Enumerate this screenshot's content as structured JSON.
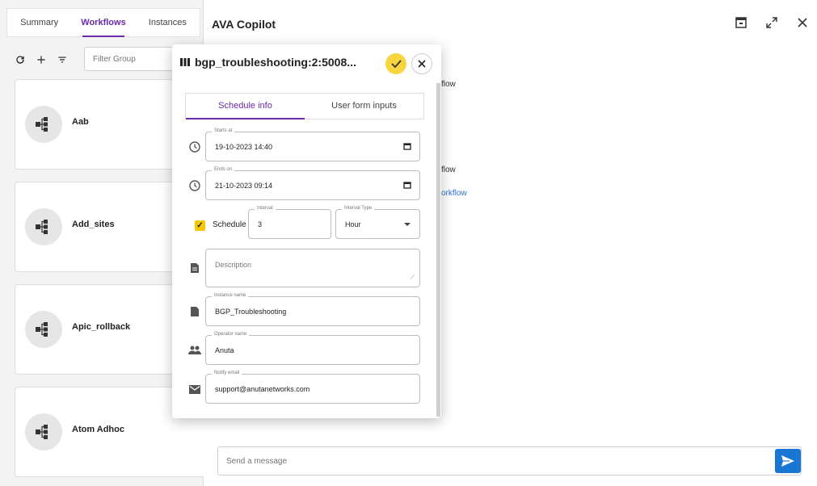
{
  "left_panel": {
    "tabs": [
      "Summary",
      "Workflows",
      "Instances"
    ],
    "active_tab": "Workflows",
    "toolbar": {
      "refresh_icon": "refresh-icon",
      "add_icon": "plus-icon",
      "filter_icon": "filter-icon",
      "filter_placeholder": "Filter Group"
    },
    "workflows": [
      {
        "name": "Aab"
      },
      {
        "name": "Add_sites"
      },
      {
        "name": "Apic_rollback"
      },
      {
        "name": "Atom Adhoc"
      }
    ]
  },
  "right_panel": {
    "title": "AVA Copilot",
    "header_icons": [
      "open-in-panel-icon",
      "expand-icon",
      "close-icon"
    ],
    "chat_fragments": {
      "line1": "flow",
      "line2": "flow",
      "line3": "orkflow"
    },
    "message_placeholder": "Send a message",
    "send_icon": "send-icon"
  },
  "modal": {
    "title": "bgp_troubleshooting:2:5008...",
    "confirm_icon": "check-icon",
    "close_icon": "close-icon",
    "tabs": [
      "Schedule info",
      "User form inputs"
    ],
    "active_tab": "Schedule info",
    "starts_at": {
      "label": "Starts at",
      "value": "19-10-2023 14:40"
    },
    "ends_on": {
      "label": "Ends on",
      "value": "21-10-2023 09:14"
    },
    "schedule": {
      "label": "Schedule",
      "checked": true
    },
    "interval": {
      "label": "Interval",
      "value": "3"
    },
    "interval_type": {
      "label": "Interval Type",
      "value": "Hour"
    },
    "description": {
      "placeholder": "Description"
    },
    "instance_name": {
      "label": "Instance name",
      "value": "BGP_Troubleshooting"
    },
    "operator_name": {
      "label": "Operator name",
      "value": "Anuta"
    },
    "notify_email": {
      "label": "Notify email",
      "value": "support@anutanetworks.com"
    }
  },
  "colors": {
    "accent_purple": "#6b2aa8",
    "confirm_yellow": "#f7d53e",
    "checkbox_yellow": "#f5c800",
    "send_blue": "#1976d2",
    "link_blue": "#2d6fd6"
  }
}
